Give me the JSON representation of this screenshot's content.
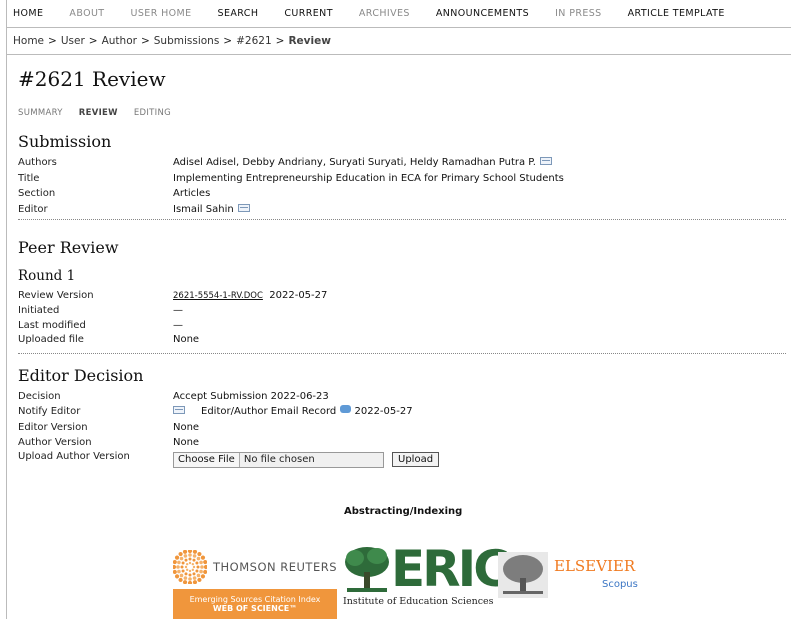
{
  "nav": {
    "items": [
      {
        "label": "HOME",
        "dim": false
      },
      {
        "label": "ABOUT",
        "dim": true
      },
      {
        "label": "USER HOME",
        "dim": true
      },
      {
        "label": "SEARCH",
        "dim": false
      },
      {
        "label": "CURRENT",
        "dim": false
      },
      {
        "label": "ARCHIVES",
        "dim": true
      },
      {
        "label": "ANNOUNCEMENTS",
        "dim": false
      },
      {
        "label": "IN PRESS",
        "dim": true
      },
      {
        "label": "ARTICLE TEMPLATE",
        "dim": false
      }
    ]
  },
  "breadcrumb": {
    "items": [
      "Home",
      "User",
      "Author",
      "Submissions",
      "#2621"
    ],
    "current": "Review",
    "separator": ">"
  },
  "page": {
    "title": "#2621 Review",
    "tabs": [
      "SUMMARY",
      "REVIEW",
      "EDITING"
    ],
    "active_tab": "REVIEW"
  },
  "submission": {
    "heading": "Submission",
    "authors_label": "Authors",
    "authors": "Adisel Adisel, Debby Andriany, Suryati Suryati, Heldy Ramadhan Putra P.",
    "title_label": "Title",
    "title": "Implementing Entrepreneurship Education in ECA for Primary School Students",
    "section_label": "Section",
    "section": "Articles",
    "editor_label": "Editor",
    "editor": "Ismail Sahin"
  },
  "peer_review": {
    "heading": "Peer Review",
    "round": "Round 1",
    "review_version_label": "Review Version",
    "review_version_file": "2621-5554-1-RV.DOC",
    "review_version_date": "2022-05-27",
    "initiated_label": "Initiated",
    "initiated": "—",
    "last_modified_label": "Last modified",
    "last_modified": "—",
    "uploaded_file_label": "Uploaded file",
    "uploaded_file": "None"
  },
  "editor_decision": {
    "heading": "Editor Decision",
    "decision_label": "Decision",
    "decision": "Accept Submission 2022-06-23",
    "notify_label": "Notify Editor",
    "notify_record": "Editor/Author Email Record",
    "notify_date": "2022-05-27",
    "editor_version_label": "Editor Version",
    "editor_version": "None",
    "author_version_label": "Author Version",
    "author_version": "None",
    "upload_label": "Upload Author Version",
    "choose_file": "Choose File",
    "no_file": "No file chosen",
    "upload_button": "Upload"
  },
  "indexing": {
    "title": "Abstracting/Indexing",
    "thomson_name": "THOMSON REUTERS",
    "thomson_band_1": "Emerging Sources Citation Index",
    "thomson_band_2": "WEB OF SCIENCE™",
    "eric_word": "ERIC",
    "eric_sub": "Institute of Education Sciences",
    "elsevier_word": "ELSEVIER",
    "scopus_word": "Scopus"
  },
  "colors": {
    "thomson_orange": "#f0963c",
    "eric_green": "#2e6b3a",
    "elsevier_orange": "#f07a20",
    "scopus_blue": "#3b76c4"
  }
}
